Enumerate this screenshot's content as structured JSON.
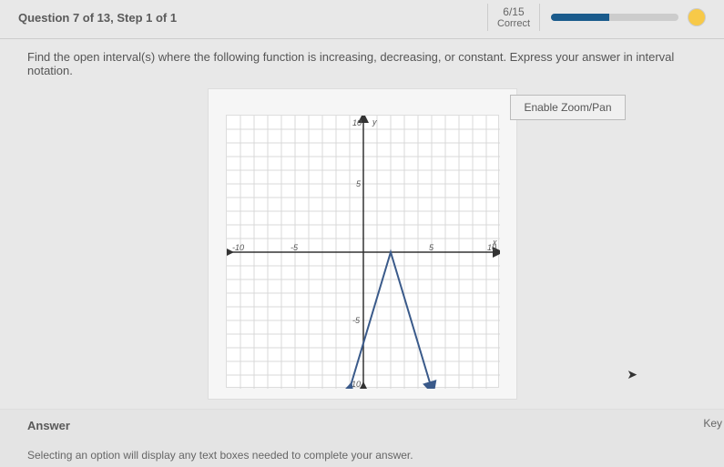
{
  "header": {
    "title": "Question 7 of 13, Step 1 of 1",
    "score_fraction": "6/15",
    "score_label": "Correct"
  },
  "prompt": "Find the open interval(s) where the following function is increasing, decreasing, or constant. Express your answer in interval notation.",
  "zoom_button": "Enable Zoom/Pan",
  "chart_data": {
    "type": "line",
    "title": "",
    "xlabel": "x",
    "ylabel": "y",
    "xlim": [
      -10,
      10
    ],
    "ylim": [
      -10,
      10
    ],
    "x_ticks": [
      -10,
      -5,
      5,
      10
    ],
    "y_ticks": [
      -10,
      -5,
      5,
      10
    ],
    "x": [
      -1,
      2,
      5
    ],
    "y": [
      -10,
      0,
      -10
    ],
    "arrows_at_ends": true
  },
  "answer": {
    "label": "Answer",
    "hint": "Selecting an option will display any text boxes needed to complete your answer.",
    "key_label": "Key"
  }
}
